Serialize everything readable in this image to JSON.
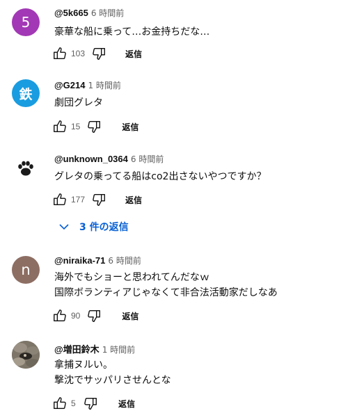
{
  "comments": [
    {
      "avatar_letter": "5",
      "avatar_color": "#a238b5",
      "author": "@5k665",
      "time": "6 時間前",
      "lines": [
        "豪華な船に乗って…お金持ちだな…"
      ],
      "likes": "103",
      "reply_label": "返信"
    },
    {
      "avatar_letter": "鉄",
      "avatar_color": "#1a9ce0",
      "author": "@G214",
      "time": "1 時間前",
      "lines": [
        "劇団グレタ"
      ],
      "likes": "15",
      "reply_label": "返信"
    },
    {
      "avatar_icon": "paw-icon",
      "author": "@unknown_0364",
      "time": "6 時間前",
      "lines": [
        "グレタの乗ってる船はco2出さないやつですか？"
      ],
      "likes": "177",
      "reply_label": "返信",
      "replies_label": "3 件の返信"
    },
    {
      "avatar_letter": "n",
      "avatar_color": "#8d6e63",
      "author": "@niraika-71",
      "time": "6 時間前",
      "lines": [
        "海外でもショーと思われてんだなｗ",
        "国際ボランティアじゃなくて非合法活動家だしなあ"
      ],
      "likes": "90",
      "reply_label": "返信"
    },
    {
      "avatar_icon": "photo-avatar",
      "author": "@増田鈴木",
      "time": "1 時間前",
      "lines": [
        "拿捕ヌルい。",
        "撃沈でサッパリさせんとな"
      ],
      "likes": "5",
      "reply_label": "返信"
    }
  ],
  "colors": {
    "text": "#0f0f0f",
    "secondary": "#606060",
    "link_blue": "#065fd4"
  }
}
